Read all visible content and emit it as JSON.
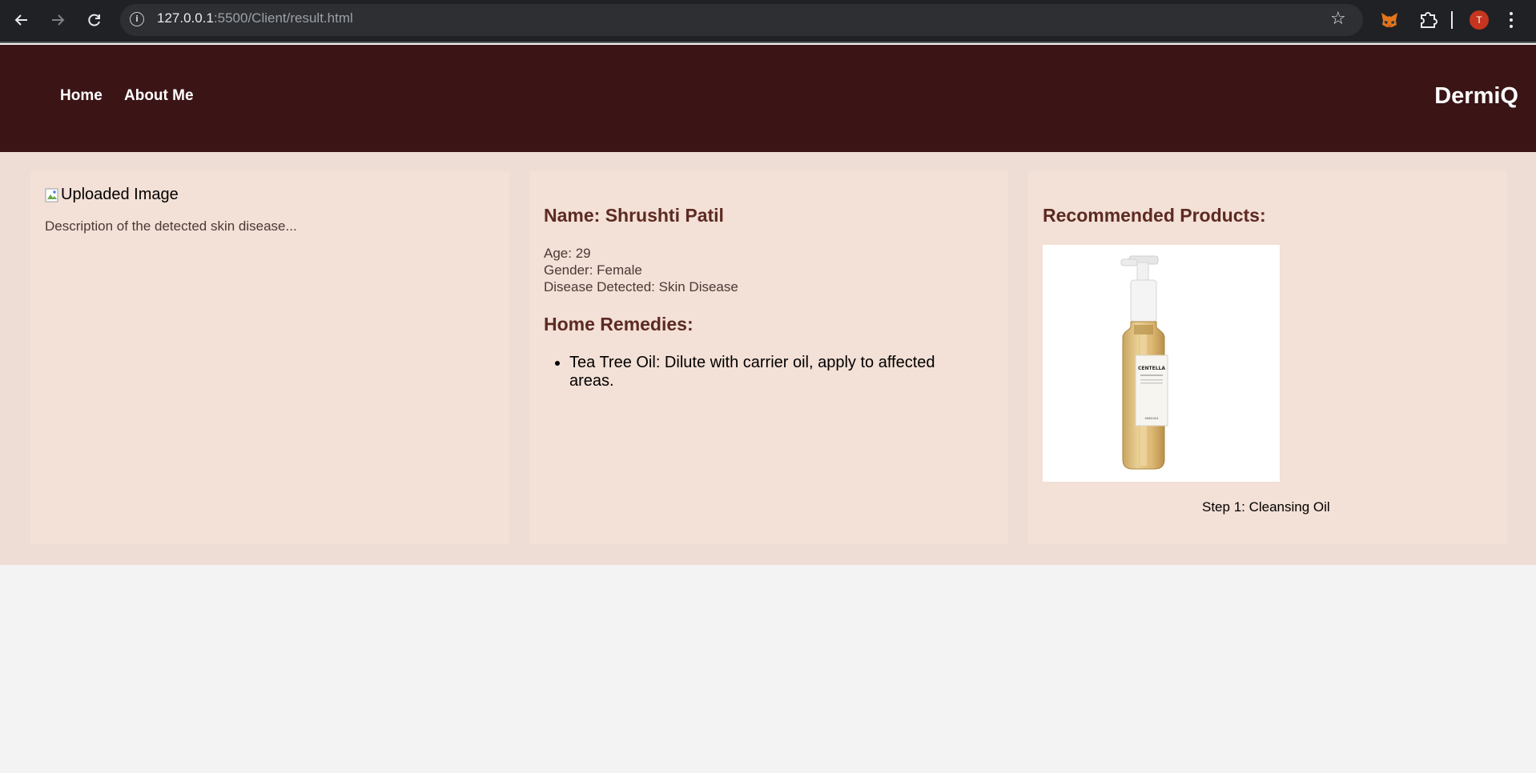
{
  "browser": {
    "url_host": "127.0.0.1",
    "url_path": ":5500/Client/result.html",
    "avatar_letter": "T"
  },
  "header": {
    "nav": [
      "Home",
      "About Me"
    ],
    "brand": "DermiQ",
    "background": "#3b1416"
  },
  "upload_card": {
    "image_alt": "Uploaded Image",
    "description": "Description of the detected skin disease..."
  },
  "patient_card": {
    "name_heading": "Name: Shrushti Patil",
    "age": "Age: 29",
    "gender": "Gender: Female",
    "disease": "Disease Detected: Skin Disease",
    "remedies_heading": "Home Remedies:",
    "remedies": [
      "Tea Tree Oil: Dilute with carrier oil, apply to affected areas."
    ]
  },
  "products_card": {
    "heading": "Recommended Products:",
    "product_brand": "CENTELLA",
    "product_maker": "SKIN1004",
    "product_caption": "Step 1: Cleansing Oil"
  },
  "colors": {
    "heading": "#5c2a22",
    "card": "#f3e0d6",
    "content_bg": "#eeddd5",
    "page_bg": "#f4f3f3"
  }
}
